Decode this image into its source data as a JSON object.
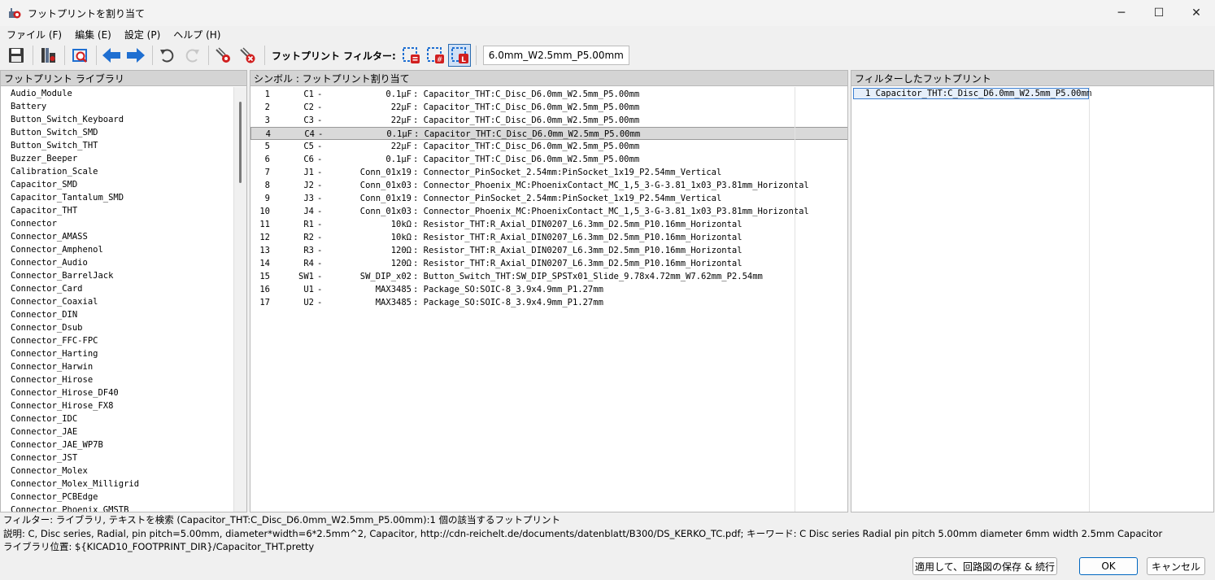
{
  "window": {
    "title": "フットプリントを割り当て",
    "minimize": "─",
    "maximize": "☐",
    "close": "✕"
  },
  "menu": [
    "ファイル (F)",
    "編集 (E)",
    "設定 (P)",
    "ヘルプ (H)"
  ],
  "toolbar": {
    "filter_label": "フットプリント フィルター:",
    "filter_value": "6.0mm_W2.5mm_P5.00mm"
  },
  "library_panel": {
    "header": "フットプリント ライブラリ",
    "items": [
      "Audio_Module",
      "Battery",
      "Button_Switch_Keyboard",
      "Button_Switch_SMD",
      "Button_Switch_THT",
      "Buzzer_Beeper",
      "Calibration_Scale",
      "Capacitor_SMD",
      "Capacitor_Tantalum_SMD",
      "Capacitor_THT",
      "Connector",
      "Connector_AMASS",
      "Connector_Amphenol",
      "Connector_Audio",
      "Connector_BarrelJack",
      "Connector_Card",
      "Connector_Coaxial",
      "Connector_DIN",
      "Connector_Dsub",
      "Connector_FFC-FPC",
      "Connector_Harting",
      "Connector_Harwin",
      "Connector_Hirose",
      "Connector_Hirose_DF40",
      "Connector_Hirose_FX8",
      "Connector_IDC",
      "Connector_JAE",
      "Connector_JAE_WP7B",
      "Connector_JST",
      "Connector_Molex",
      "Connector_Molex_Milligrid",
      "Connector_PCBEdge",
      "Connector_Phoenix_GMSTB"
    ]
  },
  "symbol_panel": {
    "header": "シンボル : フットプリント割り当て",
    "selected_index": 3,
    "rows": [
      {
        "num": "1",
        "ref": "C1",
        "value": "0.1μF",
        "footprint": "Capacitor_THT:C_Disc_D6.0mm_W2.5mm_P5.00mm"
      },
      {
        "num": "2",
        "ref": "C2",
        "value": "22μF",
        "footprint": "Capacitor_THT:C_Disc_D6.0mm_W2.5mm_P5.00mm"
      },
      {
        "num": "3",
        "ref": "C3",
        "value": "22μF",
        "footprint": "Capacitor_THT:C_Disc_D6.0mm_W2.5mm_P5.00mm"
      },
      {
        "num": "4",
        "ref": "C4",
        "value": "0.1μF",
        "footprint": "Capacitor_THT:C_Disc_D6.0mm_W2.5mm_P5.00mm"
      },
      {
        "num": "5",
        "ref": "C5",
        "value": "22μF",
        "footprint": "Capacitor_THT:C_Disc_D6.0mm_W2.5mm_P5.00mm"
      },
      {
        "num": "6",
        "ref": "C6",
        "value": "0.1μF",
        "footprint": "Capacitor_THT:C_Disc_D6.0mm_W2.5mm_P5.00mm"
      },
      {
        "num": "7",
        "ref": "J1",
        "value": "Conn_01x19",
        "footprint": "Connector_PinSocket_2.54mm:PinSocket_1x19_P2.54mm_Vertical"
      },
      {
        "num": "8",
        "ref": "J2",
        "value": "Conn_01x03",
        "footprint": "Connector_Phoenix_MC:PhoenixContact_MC_1,5_3-G-3.81_1x03_P3.81mm_Horizontal"
      },
      {
        "num": "9",
        "ref": "J3",
        "value": "Conn_01x19",
        "footprint": "Connector_PinSocket_2.54mm:PinSocket_1x19_P2.54mm_Vertical"
      },
      {
        "num": "10",
        "ref": "J4",
        "value": "Conn_01x03",
        "footprint": "Connector_Phoenix_MC:PhoenixContact_MC_1,5_3-G-3.81_1x03_P3.81mm_Horizontal"
      },
      {
        "num": "11",
        "ref": "R1",
        "value": "10kΩ",
        "footprint": "Resistor_THT:R_Axial_DIN0207_L6.3mm_D2.5mm_P10.16mm_Horizontal"
      },
      {
        "num": "12",
        "ref": "R2",
        "value": "10kΩ",
        "footprint": "Resistor_THT:R_Axial_DIN0207_L6.3mm_D2.5mm_P10.16mm_Horizontal"
      },
      {
        "num": "13",
        "ref": "R3",
        "value": "120Ω",
        "footprint": "Resistor_THT:R_Axial_DIN0207_L6.3mm_D2.5mm_P10.16mm_Horizontal"
      },
      {
        "num": "14",
        "ref": "R4",
        "value": "120Ω",
        "footprint": "Resistor_THT:R_Axial_DIN0207_L6.3mm_D2.5mm_P10.16mm_Horizontal"
      },
      {
        "num": "15",
        "ref": "SW1",
        "value": "SW_DIP_x02",
        "footprint": "Button_Switch_THT:SW_DIP_SPSTx01_Slide_9.78x4.72mm_W7.62mm_P2.54mm"
      },
      {
        "num": "16",
        "ref": "U1",
        "value": "MAX3485",
        "footprint": "Package_SO:SOIC-8_3.9x4.9mm_P1.27mm"
      },
      {
        "num": "17",
        "ref": "U2",
        "value": "MAX3485",
        "footprint": "Package_SO:SOIC-8_3.9x4.9mm_P1.27mm"
      }
    ]
  },
  "filtered_panel": {
    "header": "フィルターしたフットプリント",
    "rows": [
      "1 Capacitor_THT:C_Disc_D6.0mm_W2.5mm_P5.00mm"
    ]
  },
  "status": {
    "filter_line": "フィルター: ライブラリ, テキストを検索 (Capacitor_THT:C_Disc_D6.0mm_W2.5mm_P5.00mm):1 個の該当するフットプリント",
    "description_line": "説明: C, Disc series, Radial, pin pitch=5.00mm, diameter*width=6*2.5mm^2, Capacitor, http://cdn-reichelt.de/documents/datenblatt/B300/DS_KERKO_TC.pdf;  キーワード: C Disc series Radial pin pitch 5.00mm diameter 6mm width 2.5mm Capacitor",
    "library_line": "ライブラリ位置: ${KICAD10_FOOTPRINT_DIR}/Capacitor_THT.pretty"
  },
  "buttons": {
    "apply_save": "適用して、回路図の保存 & 続行",
    "ok": "OK",
    "cancel": "キャンセル"
  },
  "colors": {
    "accent_blue": "#1f6fd1",
    "highlight_red": "#d11f1f",
    "panel_header": "#d4d4d4"
  }
}
